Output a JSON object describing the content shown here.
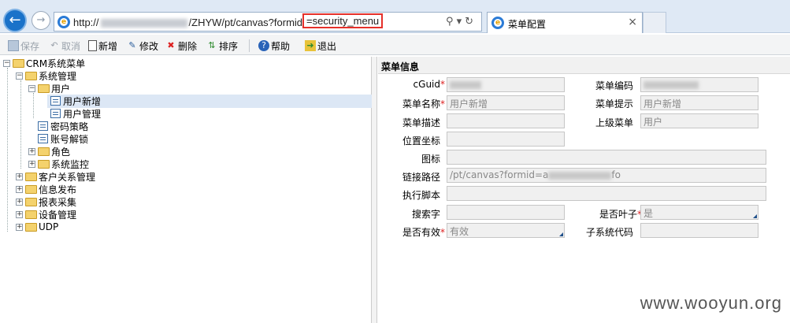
{
  "browser": {
    "url_prefix": "http://",
    "url_mid": "/ZHYW/pt/canvas?formid",
    "url_highlight": "=security_menu",
    "tab_title": "菜单配置",
    "tab_close": "×"
  },
  "toolbar": {
    "save": "保存",
    "cancel": "取消",
    "add": "新增",
    "edit": "修改",
    "delete": "删除",
    "sort": "排序",
    "help": "帮助",
    "exit": "退出"
  },
  "tree": {
    "root": "CRM系统菜单",
    "sys_mgmt": "系统管理",
    "user": "用户",
    "user_add": "用户新增",
    "user_mgmt": "用户管理",
    "pwd_policy": "密码策略",
    "acct_unlock": "账号解锁",
    "role": "角色",
    "sys_monitor": "系统监控",
    "crm": "客户关系管理",
    "info_pub": "信息发布",
    "report": "报表采集",
    "device": "设备管理",
    "udp": "UDP"
  },
  "form": {
    "title": "菜单信息",
    "cguid_label": "cGuid",
    "menu_code_label": "菜单编码",
    "menu_name_label": "菜单名称",
    "menu_name_value": "用户新增",
    "menu_tip_label": "菜单提示",
    "menu_tip_value": "用户新增",
    "menu_desc_label": "菜单描述",
    "parent_label": "上级菜单",
    "parent_value": "用户",
    "position_label": "位置坐标",
    "icon_label": "图标",
    "link_label": "链接路径",
    "link_value_a": "/pt/canvas?formid=a",
    "link_value_b": "fo",
    "script_label": "执行脚本",
    "keyword_label": "搜索字",
    "is_leaf_label": "是否叶子",
    "is_leaf_value": "是",
    "is_valid_label": "是否有效",
    "is_valid_value": "有效",
    "subsys_label": "子系统代码",
    "required_mark": "*"
  },
  "watermark": "www.wooyun.org"
}
